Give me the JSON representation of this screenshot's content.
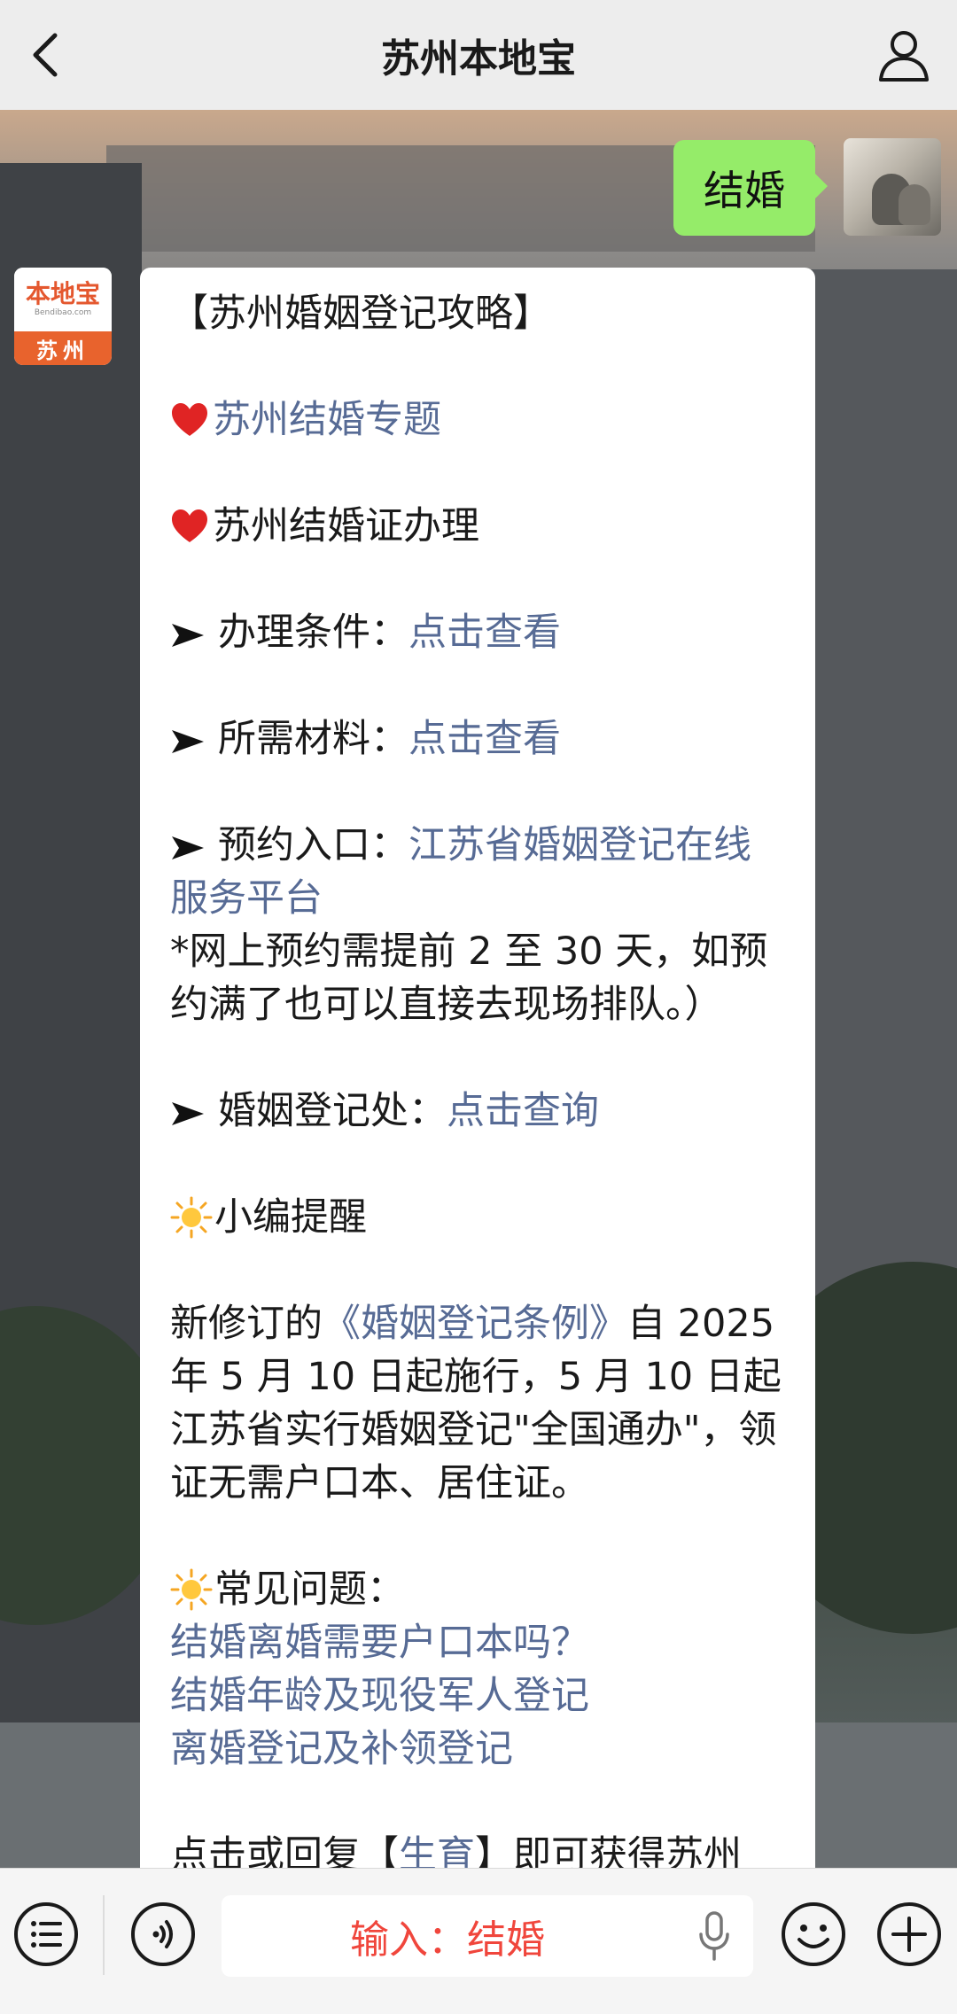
{
  "header": {
    "title": "苏州本地宝"
  },
  "chat": {
    "sent_message": "结婚",
    "bot_avatar": {
      "logo_text": "本地宝",
      "logo_sub": "Bendibao.com",
      "city": "苏州"
    },
    "reply": {
      "title": "【苏州婚姻登记攻略】",
      "topic_link": "苏州结婚专题",
      "certificate": "苏州结婚证办理",
      "conditions_label": "办理条件：",
      "conditions_link": "点击查看",
      "materials_label": "所需材料：",
      "materials_link": "点击查看",
      "booking_label": "预约入口：",
      "booking_link": "江苏省婚姻登记在线服务平台",
      "booking_note": "*网上预约需提前 2 至 30 天，如预约满了也可以直接去现场排队。）",
      "office_label": "婚姻登记处：",
      "office_link": "点击查询",
      "reminder_title": "小编提醒",
      "reminder_prefix": "新修订的",
      "reminder_link": "《婚姻登记条例》",
      "reminder_text": "自 2025 年 5 月 10 日起施行，5 月 10 日起江苏省实行婚姻登记\"全国通办\"，领证无需户口本、居住证。",
      "faq_title": "常见问题：",
      "faq_links": [
        "结婚离婚需要户口本吗？",
        "结婚年龄及现役军人登记",
        "离婚登记及补领登记"
      ],
      "partial_prefix": "点击或回复【",
      "partial_link": "生育",
      "partial_suffix": "】即可获得苏州"
    }
  },
  "input_bar": {
    "input_value": "输入：结婚"
  },
  "colors": {
    "link": "#576b95",
    "sent_bubble": "#95ec69",
    "input_text": "#f0463c"
  }
}
